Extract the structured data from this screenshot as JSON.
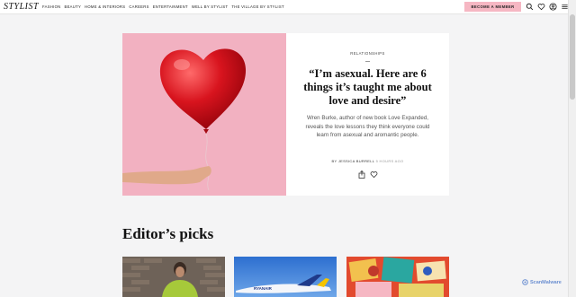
{
  "site": {
    "logo": "STYLIST"
  },
  "nav": {
    "items": [
      "FASHION",
      "BEAUTY",
      "HOME & INTERIORS",
      "CAREERS",
      "ENTERTAINMENT",
      "WELL BY STYLIST",
      "THE VILLAGE BY STYLIST"
    ],
    "member_button": "BECOME A MEMBER",
    "icons": [
      "search-icon",
      "heart-icon",
      "account-icon",
      "menu-icon"
    ]
  },
  "hero": {
    "category": "RELATIONSHIPS",
    "headline": "“I’m asexual. Here are 6 things it’s taught me about love and desire”",
    "standfirst": "Wren Burke, author of new book Love Expanded, reveals the love lessons they think everyone could learn from asexual and aromantic people.",
    "byline_prefix": "BY",
    "author": "JESSICA BURRELL",
    "time": "5 HOURS AGO",
    "image": "red heart balloon held by hand on pink background"
  },
  "section": {
    "title": "Editor’s picks"
  },
  "picks": [
    {
      "image": "woman in green top against brick wall"
    },
    {
      "image": "Ryanair plane in blue sky"
    },
    {
      "image": "colourful retro posters"
    }
  ],
  "watermark": "ScanMalware",
  "colors": {
    "accent": "#f6b7c3",
    "hero_bg": "#f2b1c1",
    "page_bg": "#f4f4f5"
  }
}
